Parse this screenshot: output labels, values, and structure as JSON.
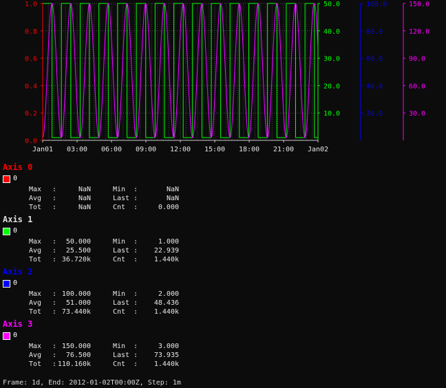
{
  "chart_data": {
    "type": "line",
    "x_range": [
      "2012-01-01T00:00",
      "2012-01-02T00:00"
    ],
    "x_ticks": [
      "Jan01",
      "03:00",
      "06:00",
      "09:00",
      "12:00",
      "15:00",
      "18:00",
      "21:00",
      "Jan02"
    ],
    "grid": true,
    "axes": [
      {
        "name": "Axis 0",
        "color": "#ff0000",
        "range": [
          0,
          1
        ],
        "ticks": [
          "0.0",
          "0.2",
          "0.4",
          "0.6",
          "0.8",
          "1.0"
        ]
      },
      {
        "name": "Axis 1",
        "color": "#00ff00",
        "range": [
          0,
          50
        ],
        "ticks": [
          "10.0",
          "20.0",
          "30.0",
          "40.0",
          "50.0"
        ]
      },
      {
        "name": "Axis 2",
        "color": "#0000ff",
        "range": [
          0,
          100
        ],
        "ticks": [
          "20.0",
          "40.0",
          "60.0",
          "80.0",
          "100.0"
        ]
      },
      {
        "name": "Axis 3",
        "color": "#ff00ff",
        "range": [
          0,
          150
        ],
        "ticks": [
          "30.0",
          "60.0",
          "90.0",
          "120.0",
          "150.0"
        ]
      }
    ],
    "series": [
      {
        "name": "0",
        "axis": 0,
        "color": "#ff0000",
        "values": []
      },
      {
        "name": "0",
        "axis": 1,
        "color": "#00ff00",
        "shape": "square",
        "min": 1,
        "max": 50,
        "period_minutes": 98
      },
      {
        "name": "0",
        "axis": 2,
        "color": "#0000ff",
        "shape": "sine",
        "min": 2,
        "max": 100,
        "period_minutes": 98
      },
      {
        "name": "0",
        "axis": 3,
        "color": "#ff00ff",
        "shape": "sine",
        "min": 3,
        "max": 150,
        "period_minutes": 98
      }
    ]
  },
  "legend": [
    {
      "title": "Axis 0",
      "color": "#ff0000",
      "series": "0",
      "stats": {
        "max": "NaN",
        "min": "NaN",
        "avg": "NaN",
        "last": "NaN",
        "tot": "NaN",
        "cnt": "0.000"
      }
    },
    {
      "title": "Axis 1",
      "color": "#dddddd",
      "swatch": "#00ff00",
      "series": "0",
      "stats": {
        "max": "50.000",
        "min": "1.000",
        "avg": "25.500",
        "last": "22.939",
        "tot": "36.720k",
        "cnt": "1.440k"
      }
    },
    {
      "title": "Axis 2",
      "color": "#0000ff",
      "swatch": "#0000ff",
      "series": "0",
      "stats": {
        "max": "100.000",
        "min": "2.000",
        "avg": "51.000",
        "last": "48.436",
        "tot": "73.440k",
        "cnt": "1.440k"
      }
    },
    {
      "title": "Axis 3",
      "color": "#ff00ff",
      "swatch": "#ff00ff",
      "series": "0",
      "stats": {
        "max": "150.000",
        "min": "3.000",
        "avg": "76.500",
        "last": "73.935",
        "tot": "110.160k",
        "cnt": "1.440k"
      }
    }
  ],
  "labels": {
    "max": "Max",
    "min": "Min",
    "avg": "Avg",
    "last": "Last",
    "tot": "Tot",
    "cnt": "Cnt",
    "sep": ":"
  },
  "footer": "Frame: 1d, End: 2012-01-02T00:00Z, Step: 1m"
}
